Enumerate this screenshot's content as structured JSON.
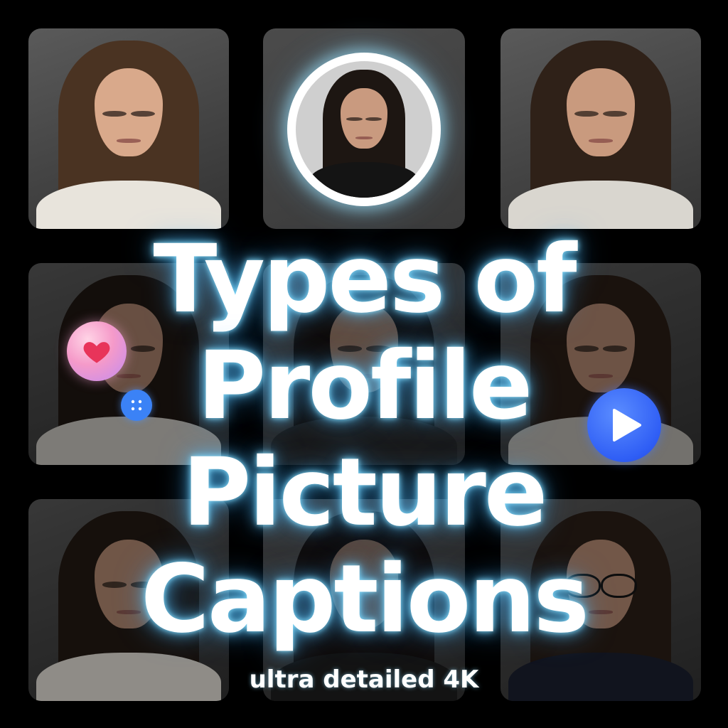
{
  "title": {
    "line1": "Types of",
    "line2": "Profile",
    "line3": "Picture",
    "line4": "Captions"
  },
  "subtitle": "ultra detailed 4K",
  "icons": {
    "heart": "heart-icon",
    "dots": "four-dots-icon",
    "play": "play-icon"
  },
  "colors": {
    "background": "#000000",
    "title_glow": "#8ce1ff",
    "play_badge": "#2f5ef5",
    "heart_badge": "#f59ac9",
    "dots_badge": "#3b82f6"
  }
}
